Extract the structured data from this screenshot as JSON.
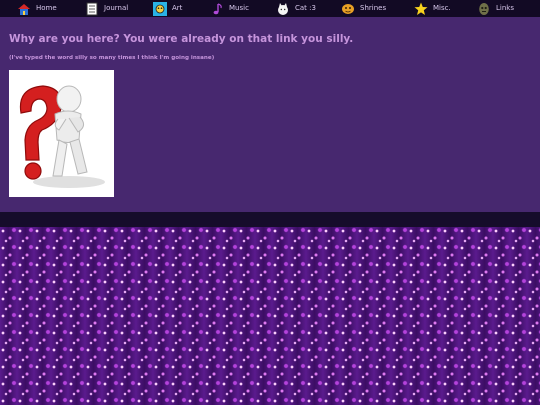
{
  "nav": {
    "items": [
      {
        "label": "Home",
        "icon": "house-icon"
      },
      {
        "label": "Journal",
        "icon": "journal-icon"
      },
      {
        "label": "Art",
        "icon": "art-icon"
      },
      {
        "label": "Music",
        "icon": "music-note-icon"
      },
      {
        "label": "Cat :3",
        "icon": "cat-icon"
      },
      {
        "label": "Shrines",
        "icon": "shrine-icon"
      },
      {
        "label": "Misc.",
        "icon": "star-icon"
      },
      {
        "label": "Links",
        "icon": "mask-icon"
      }
    ]
  },
  "main": {
    "title": "Why are you here? You were already on that link you silly.",
    "subtitle": "(I've typed the word silly so many times I think I'm going insane)",
    "image": "question-mark-figure"
  },
  "colors": {
    "nav_bg": "#120a24",
    "content_bg": "#47286f",
    "heading": "#c695dc",
    "divider": "#160c2b",
    "glitter": "#7a2bb0"
  }
}
